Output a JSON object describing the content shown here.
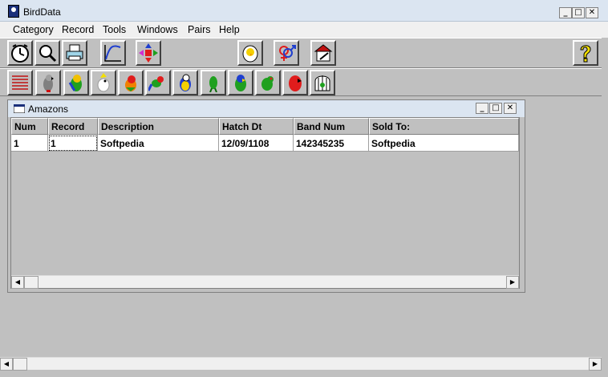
{
  "window": {
    "title": "BirdData"
  },
  "menu": [
    "Category",
    "Record",
    "Tools",
    "Windows",
    "Pairs",
    "Help"
  ],
  "toolbar1": [
    "clock-icon",
    "magnifier-icon",
    "printer-icon",
    "chart-icon",
    "move-arrows-icon",
    "egg-chick-icon",
    "gender-symbols-icon",
    "house-pen-icon",
    "help-icon"
  ],
  "toolbar2": [
    "list-icon",
    "grey-parrot-icon",
    "conure-icon",
    "cockatoo-icon",
    "caique-icon",
    "lovebird-icon",
    "macaw-icon",
    "parakeet-icon",
    "pionus-icon",
    "amazon-icon",
    "eclectus-icon",
    "birdcage-icon"
  ],
  "child": {
    "title": "Amazons"
  },
  "table": {
    "columns": [
      "Num",
      "Record",
      "Description",
      "Hatch Dt",
      "Band Num",
      "Sold To:"
    ],
    "rows": [
      [
        "1",
        "1",
        "Softpedia",
        "12/09/1108",
        "142345235",
        "Softpedia"
      ]
    ]
  },
  "colors": {
    "titlebar": "#dbe5f1",
    "menubar": "#f0f0f0",
    "face": "#c0c0c0"
  }
}
